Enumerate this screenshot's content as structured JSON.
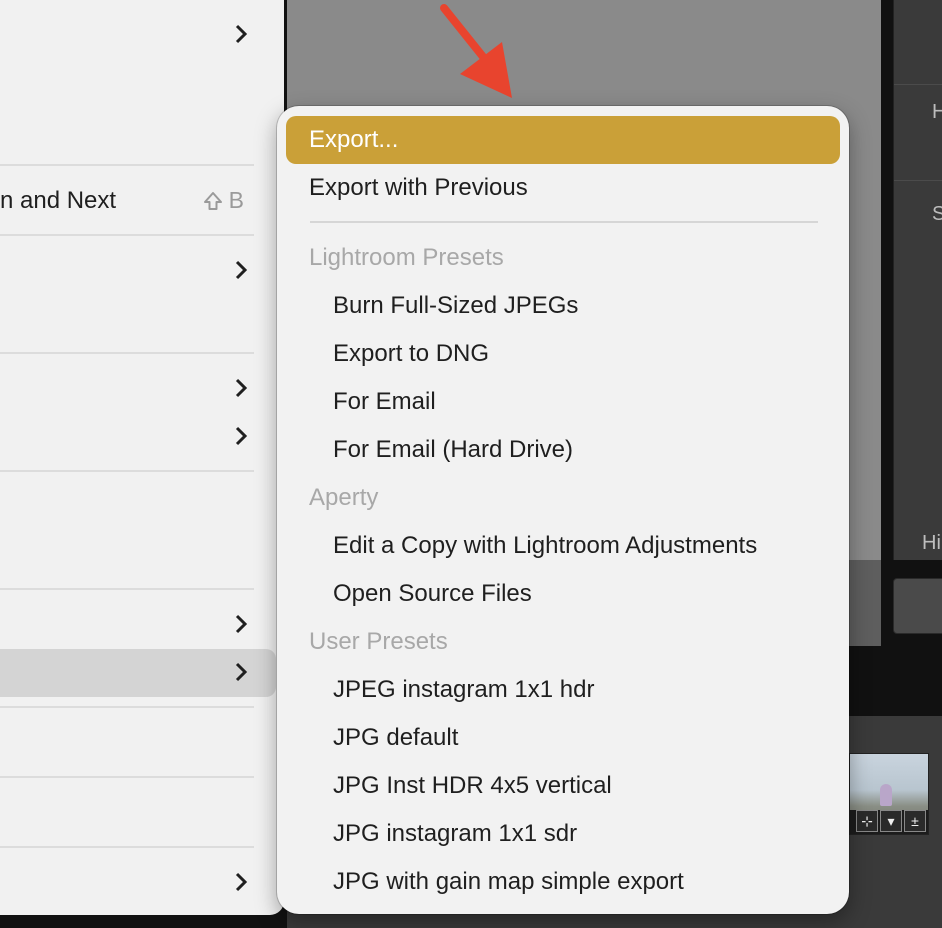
{
  "parent_menu": {
    "row_and_next_label": "n and Next",
    "row_and_next_shortcut_key": "B",
    "shortcut_icon": "shift-icon",
    "submenu_icon": "chevron-right-icon"
  },
  "export_menu": {
    "items": [
      {
        "label": "Export...",
        "highlighted": true
      },
      {
        "label": "Export with Previous"
      }
    ],
    "sections": [
      {
        "header": "Lightroom Presets",
        "items": [
          "Burn Full-Sized JPEGs",
          "Export to DNG",
          "For Email",
          "For Email (Hard Drive)"
        ]
      },
      {
        "header": "Aperty",
        "items": [
          "Edit a Copy with Lightroom Adjustments",
          "Open Source Files"
        ]
      },
      {
        "header": "User Presets",
        "items": [
          "JPEG instagram 1x1 hdr",
          "JPG default",
          "JPG Inst HDR 4x5 vertical",
          "JPG instagram 1x1 sdr",
          "JPG with gain map simple export"
        ]
      }
    ]
  },
  "right_panel": {
    "label_h": "H",
    "label_sd": "SD",
    "label_hi": "Hi"
  },
  "annotation": {
    "arrow_color": "#e8442e",
    "icon": "red-arrow-icon"
  },
  "colors": {
    "highlight": "#caa038",
    "menu_bg": "#f2f2f2",
    "header_text": "#a8a8a8"
  }
}
